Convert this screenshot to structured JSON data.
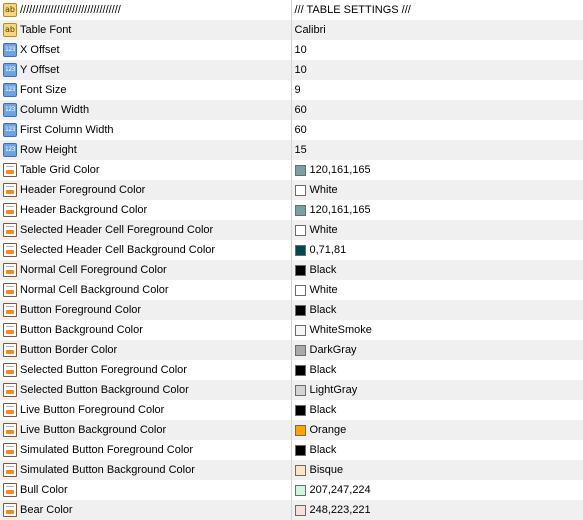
{
  "rows": [
    {
      "name": "/////////////////////////////////",
      "value": "/// TABLE SETTINGS ///",
      "icon": "abc-text-icon",
      "swatch": null
    },
    {
      "name": "Table Font",
      "value": "Calibri",
      "icon": "abc-text-icon",
      "swatch": null
    },
    {
      "name": "X Offset",
      "value": "10",
      "icon": "numeric-icon",
      "swatch": null
    },
    {
      "name": "Y Offset",
      "value": "10",
      "icon": "numeric-icon",
      "swatch": null
    },
    {
      "name": "Font Size",
      "value": "9",
      "icon": "numeric-icon",
      "swatch": null
    },
    {
      "name": "Column Width",
      "value": "60",
      "icon": "numeric-icon",
      "swatch": null
    },
    {
      "name": "First Column Width",
      "value": "60",
      "icon": "numeric-icon",
      "swatch": null
    },
    {
      "name": "Row Height",
      "value": "15",
      "icon": "numeric-icon",
      "swatch": null
    },
    {
      "name": "Table Grid Color",
      "value": "120,161,165",
      "icon": "color-icon",
      "swatch": "#78a1a5"
    },
    {
      "name": "Header Foreground Color",
      "value": "White",
      "icon": "color-icon",
      "swatch": "#ffffff"
    },
    {
      "name": "Header Background Color",
      "value": "120,161,165",
      "icon": "color-icon",
      "swatch": "#78a1a5"
    },
    {
      "name": "Selected Header Cell Foreground Color",
      "value": "White",
      "icon": "color-icon",
      "swatch": "#ffffff"
    },
    {
      "name": "Selected Header Cell Background Color",
      "value": "0,71,81",
      "icon": "color-icon",
      "swatch": "#004751"
    },
    {
      "name": "Normal Cell Foreground Color",
      "value": "Black",
      "icon": "color-icon",
      "swatch": "#000000"
    },
    {
      "name": "Normal Cell Background Color",
      "value": "White",
      "icon": "color-icon",
      "swatch": "#ffffff"
    },
    {
      "name": "Button Foreground Color",
      "value": "Black",
      "icon": "color-icon",
      "swatch": "#000000"
    },
    {
      "name": "Button Background Color",
      "value": "WhiteSmoke",
      "icon": "color-icon",
      "swatch": "#f5f5f5"
    },
    {
      "name": "Button Border Color",
      "value": "DarkGray",
      "icon": "color-icon",
      "swatch": "#a9a9a9"
    },
    {
      "name": "Selected Button Foreground Color",
      "value": "Black",
      "icon": "color-icon",
      "swatch": "#000000"
    },
    {
      "name": "Selected Button Background Color",
      "value": "LightGray",
      "icon": "color-icon",
      "swatch": "#d3d3d3"
    },
    {
      "name": "Live Button Foreground Color",
      "value": "Black",
      "icon": "color-icon",
      "swatch": "#000000"
    },
    {
      "name": "Live Button Background Color",
      "value": "Orange",
      "icon": "color-icon",
      "swatch": "#ffa500"
    },
    {
      "name": "Simulated Button Foreground Color",
      "value": "Black",
      "icon": "color-icon",
      "swatch": "#000000"
    },
    {
      "name": "Simulated Button Background Color",
      "value": "Bisque",
      "icon": "color-icon",
      "swatch": "#ffe4c4"
    },
    {
      "name": "Bull Color",
      "value": "207,247,224",
      "icon": "color-icon",
      "swatch": "#cff7e0"
    },
    {
      "name": "Bear Color",
      "value": "248,223,221",
      "icon": "color-icon",
      "swatch": "#f8dfdd"
    }
  ]
}
